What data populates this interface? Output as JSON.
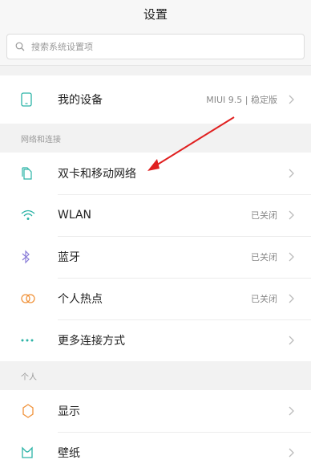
{
  "header": {
    "title": "设置"
  },
  "search": {
    "placeholder": "搜索系统设置项"
  },
  "device": {
    "label": "我的设备",
    "value": "MIUI 9.5 | 稳定版"
  },
  "network": {
    "section_title": "网络和连接",
    "items": [
      {
        "label": "双卡和移动网络",
        "value": "",
        "icon": "dual-sim-icon"
      },
      {
        "label": "WLAN",
        "value": "已关闭",
        "icon": "wifi-icon"
      },
      {
        "label": "蓝牙",
        "value": "已关闭",
        "icon": "bluetooth-icon"
      },
      {
        "label": "个人热点",
        "value": "已关闭",
        "icon": "hotspot-icon"
      },
      {
        "label": "更多连接方式",
        "value": "",
        "icon": "more-dots-icon"
      }
    ]
  },
  "personal": {
    "section_title": "个人",
    "items": [
      {
        "label": "显示",
        "icon": "display-icon"
      },
      {
        "label": "壁纸",
        "icon": "wallpaper-icon"
      }
    ]
  },
  "colors": {
    "accent": "#2bb3a6",
    "annotation_arrow": "#e02020"
  }
}
